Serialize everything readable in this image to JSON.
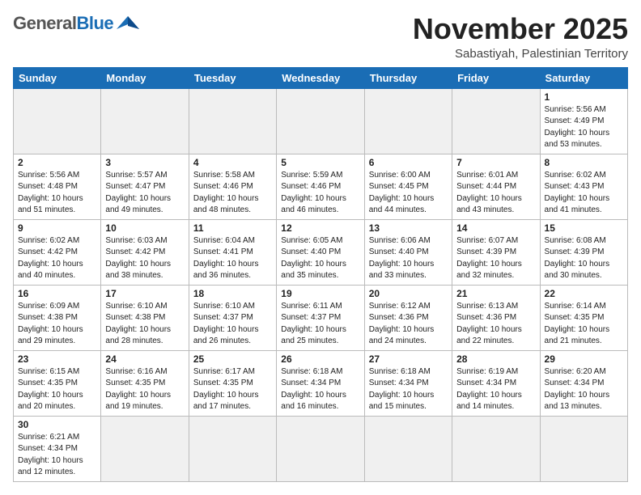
{
  "logo": {
    "general": "General",
    "blue": "Blue"
  },
  "title": "November 2025",
  "location": "Sabastiyah, Palestinian Territory",
  "weekdays": [
    "Sunday",
    "Monday",
    "Tuesday",
    "Wednesday",
    "Thursday",
    "Friday",
    "Saturday"
  ],
  "weeks": [
    [
      {
        "day": "",
        "info": ""
      },
      {
        "day": "",
        "info": ""
      },
      {
        "day": "",
        "info": ""
      },
      {
        "day": "",
        "info": ""
      },
      {
        "day": "",
        "info": ""
      },
      {
        "day": "",
        "info": ""
      },
      {
        "day": "1",
        "info": "Sunrise: 5:56 AM\nSunset: 4:49 PM\nDaylight: 10 hours and 53 minutes."
      }
    ],
    [
      {
        "day": "2",
        "info": "Sunrise: 5:56 AM\nSunset: 4:48 PM\nDaylight: 10 hours and 51 minutes."
      },
      {
        "day": "3",
        "info": "Sunrise: 5:57 AM\nSunset: 4:47 PM\nDaylight: 10 hours and 49 minutes."
      },
      {
        "day": "4",
        "info": "Sunrise: 5:58 AM\nSunset: 4:46 PM\nDaylight: 10 hours and 48 minutes."
      },
      {
        "day": "5",
        "info": "Sunrise: 5:59 AM\nSunset: 4:46 PM\nDaylight: 10 hours and 46 minutes."
      },
      {
        "day": "6",
        "info": "Sunrise: 6:00 AM\nSunset: 4:45 PM\nDaylight: 10 hours and 44 minutes."
      },
      {
        "day": "7",
        "info": "Sunrise: 6:01 AM\nSunset: 4:44 PM\nDaylight: 10 hours and 43 minutes."
      },
      {
        "day": "8",
        "info": "Sunrise: 6:02 AM\nSunset: 4:43 PM\nDaylight: 10 hours and 41 minutes."
      }
    ],
    [
      {
        "day": "9",
        "info": "Sunrise: 6:02 AM\nSunset: 4:42 PM\nDaylight: 10 hours and 40 minutes."
      },
      {
        "day": "10",
        "info": "Sunrise: 6:03 AM\nSunset: 4:42 PM\nDaylight: 10 hours and 38 minutes."
      },
      {
        "day": "11",
        "info": "Sunrise: 6:04 AM\nSunset: 4:41 PM\nDaylight: 10 hours and 36 minutes."
      },
      {
        "day": "12",
        "info": "Sunrise: 6:05 AM\nSunset: 4:40 PM\nDaylight: 10 hours and 35 minutes."
      },
      {
        "day": "13",
        "info": "Sunrise: 6:06 AM\nSunset: 4:40 PM\nDaylight: 10 hours and 33 minutes."
      },
      {
        "day": "14",
        "info": "Sunrise: 6:07 AM\nSunset: 4:39 PM\nDaylight: 10 hours and 32 minutes."
      },
      {
        "day": "15",
        "info": "Sunrise: 6:08 AM\nSunset: 4:39 PM\nDaylight: 10 hours and 30 minutes."
      }
    ],
    [
      {
        "day": "16",
        "info": "Sunrise: 6:09 AM\nSunset: 4:38 PM\nDaylight: 10 hours and 29 minutes."
      },
      {
        "day": "17",
        "info": "Sunrise: 6:10 AM\nSunset: 4:38 PM\nDaylight: 10 hours and 28 minutes."
      },
      {
        "day": "18",
        "info": "Sunrise: 6:10 AM\nSunset: 4:37 PM\nDaylight: 10 hours and 26 minutes."
      },
      {
        "day": "19",
        "info": "Sunrise: 6:11 AM\nSunset: 4:37 PM\nDaylight: 10 hours and 25 minutes."
      },
      {
        "day": "20",
        "info": "Sunrise: 6:12 AM\nSunset: 4:36 PM\nDaylight: 10 hours and 24 minutes."
      },
      {
        "day": "21",
        "info": "Sunrise: 6:13 AM\nSunset: 4:36 PM\nDaylight: 10 hours and 22 minutes."
      },
      {
        "day": "22",
        "info": "Sunrise: 6:14 AM\nSunset: 4:35 PM\nDaylight: 10 hours and 21 minutes."
      }
    ],
    [
      {
        "day": "23",
        "info": "Sunrise: 6:15 AM\nSunset: 4:35 PM\nDaylight: 10 hours and 20 minutes."
      },
      {
        "day": "24",
        "info": "Sunrise: 6:16 AM\nSunset: 4:35 PM\nDaylight: 10 hours and 19 minutes."
      },
      {
        "day": "25",
        "info": "Sunrise: 6:17 AM\nSunset: 4:35 PM\nDaylight: 10 hours and 17 minutes."
      },
      {
        "day": "26",
        "info": "Sunrise: 6:18 AM\nSunset: 4:34 PM\nDaylight: 10 hours and 16 minutes."
      },
      {
        "day": "27",
        "info": "Sunrise: 6:18 AM\nSunset: 4:34 PM\nDaylight: 10 hours and 15 minutes."
      },
      {
        "day": "28",
        "info": "Sunrise: 6:19 AM\nSunset: 4:34 PM\nDaylight: 10 hours and 14 minutes."
      },
      {
        "day": "29",
        "info": "Sunrise: 6:20 AM\nSunset: 4:34 PM\nDaylight: 10 hours and 13 minutes."
      }
    ],
    [
      {
        "day": "30",
        "info": "Sunrise: 6:21 AM\nSunset: 4:34 PM\nDaylight: 10 hours and 12 minutes."
      },
      {
        "day": "",
        "info": ""
      },
      {
        "day": "",
        "info": ""
      },
      {
        "day": "",
        "info": ""
      },
      {
        "day": "",
        "info": ""
      },
      {
        "day": "",
        "info": ""
      },
      {
        "day": "",
        "info": ""
      }
    ]
  ]
}
